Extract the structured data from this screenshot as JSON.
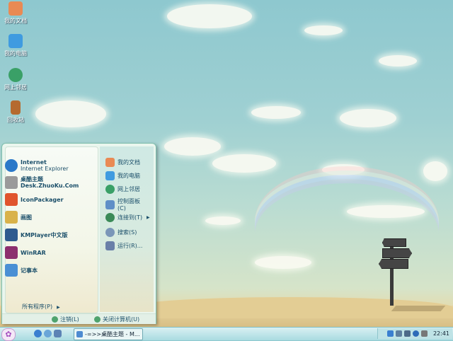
{
  "desktop_icons": [
    {
      "label": "我的文档",
      "icon": "my-documents-icon",
      "color": "#e98a54"
    },
    {
      "label": "我的电脑",
      "icon": "my-computer-icon",
      "color": "#3f9be0"
    },
    {
      "label": "网上邻居",
      "icon": "network-icon",
      "color": "#3aa067"
    },
    {
      "label": "回收站",
      "icon": "recycle-bin-icon",
      "color": "#b56a2f"
    }
  ],
  "start_menu": {
    "left_items": [
      {
        "title": "Internet",
        "subtitle": "Internet Explorer",
        "icon": "internet-explorer-icon",
        "color": "#2b79c9"
      },
      {
        "title": "桌酷主题",
        "subtitle": "Desk.ZhuoKu.Com",
        "icon": "zhuoku-icon",
        "color": "#9a9a9a"
      },
      {
        "title": "IconPackager",
        "subtitle": "",
        "icon": "iconpackager-icon",
        "color": "#e0542d"
      },
      {
        "title": "画图",
        "subtitle": "",
        "icon": "paint-icon",
        "color": "#d9b24a"
      },
      {
        "title": "KMPlayer中文版",
        "subtitle": "",
        "icon": "kmplayer-icon",
        "color": "#2f5b8f"
      },
      {
        "title": "WinRAR",
        "subtitle": "",
        "icon": "winrar-icon",
        "color": "#8c2f6e"
      },
      {
        "title": "记事本",
        "subtitle": "",
        "icon": "notepad-icon",
        "color": "#4a8fd4"
      }
    ],
    "all_programs": "所有程序(P)",
    "right_items": [
      {
        "label": "我的文档",
        "icon": "my-documents-icon",
        "color": "#e98a54",
        "arrow": false
      },
      {
        "label": "我的电脑",
        "icon": "my-computer-icon",
        "color": "#3f9be0",
        "arrow": false
      },
      {
        "label": "网上邻居",
        "icon": "network-icon",
        "color": "#3aa067",
        "arrow": false
      },
      {
        "label": "控制面板",
        "label2": "(C)",
        "icon": "control-panel-icon",
        "color": "#5f8fc7",
        "arrow": false
      },
      {
        "label": "连接到(T)",
        "icon": "connect-icon",
        "color": "#3a8a57",
        "arrow": true
      },
      {
        "label": "搜索(S)",
        "icon": "search-icon",
        "color": "#7a96b8",
        "arrow": false
      },
      {
        "label": "运行(R)...",
        "icon": "run-icon",
        "color": "#6a7fa8",
        "arrow": false
      }
    ],
    "logoff": "注销(L)",
    "shutdown": "关闭计算机(U)"
  },
  "taskbar": {
    "task_label": "-=>>桌酷主题 - M...",
    "clock": "22:41"
  },
  "colors": {
    "sky": "#9fd0d2",
    "sand": "#e3cd94",
    "accent": "#1b4f6a"
  }
}
